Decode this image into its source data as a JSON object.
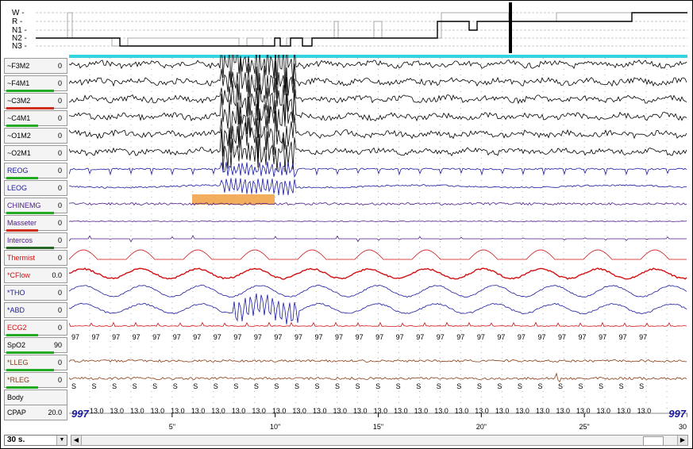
{
  "hypnogram": {
    "stages": [
      "W -",
      "R -",
      "N1 -",
      "N2 -",
      "N3 -"
    ]
  },
  "channels": [
    {
      "name": "~F3M2",
      "scale": "0",
      "color": "#000000",
      "bar": ""
    },
    {
      "name": "~F4M1",
      "scale": "0",
      "color": "#000000",
      "bar": "#22aa22"
    },
    {
      "name": "~C3M2",
      "scale": "0",
      "color": "#000000",
      "bar": "#d03020"
    },
    {
      "name": "~C4M1",
      "scale": "0",
      "color": "#000000",
      "bar": "#22aa22"
    },
    {
      "name": "~O1M2",
      "scale": "0",
      "color": "#000000",
      "bar": ""
    },
    {
      "name": "~O2M1",
      "scale": "0",
      "color": "#000000",
      "bar": ""
    },
    {
      "name": "REOG",
      "scale": "0",
      "color": "#1a1aa0",
      "bar": "#22aa22"
    },
    {
      "name": "LEOG",
      "scale": "0",
      "color": "#1a1aa0",
      "bar": ""
    },
    {
      "name": "CHINEMG",
      "scale": "0",
      "color": "#4a1a8a",
      "bar": "#22aa22"
    },
    {
      "name": "Masseter",
      "scale": "0",
      "color": "#4a1a8a",
      "bar": "#d03020"
    },
    {
      "name": "Intercos",
      "scale": "0",
      "color": "#4a1a8a",
      "bar": "#226622"
    },
    {
      "name": "Thermist",
      "scale": "0",
      "color": "#d01010",
      "bar": ""
    },
    {
      "name": "*CFlow",
      "scale": "0.0",
      "color": "#d01010",
      "bar": ""
    },
    {
      "name": "*THO",
      "scale": "0",
      "color": "#1a1aa0",
      "bar": ""
    },
    {
      "name": "*ABD",
      "scale": "0",
      "color": "#1a1aa0",
      "bar": ""
    },
    {
      "name": "ECG2",
      "scale": "0",
      "color": "#d01010",
      "bar": "#22aa22"
    },
    {
      "name": "SpO2",
      "scale": "90",
      "color": "#000000",
      "bar": "#22aa22"
    },
    {
      "name": "*LLEG",
      "scale": "0",
      "color": "#8a3a10",
      "bar": "#22aa22"
    },
    {
      "name": "*RLEG",
      "scale": "0",
      "color": "#8a3a10",
      "bar": "#22aa22"
    },
    {
      "name": "Body",
      "scale": "",
      "color": "#000000",
      "bar": ""
    },
    {
      "name": "CPAP",
      "scale": "20.0",
      "color": "#000000",
      "bar": ""
    }
  ],
  "spo2_value": "97",
  "body_value": "S",
  "cpap_value": "13.0",
  "epoch_left": "997",
  "epoch_right": "997",
  "time_ticks": [
    "5\"",
    "10\"",
    "15\"",
    "20\"",
    "25\"",
    "30"
  ],
  "range_select": "30 s.",
  "colors": {
    "top_bar": "#33d6e0",
    "event_box": "#f0a040",
    "grid": "#b0b0b0"
  }
}
